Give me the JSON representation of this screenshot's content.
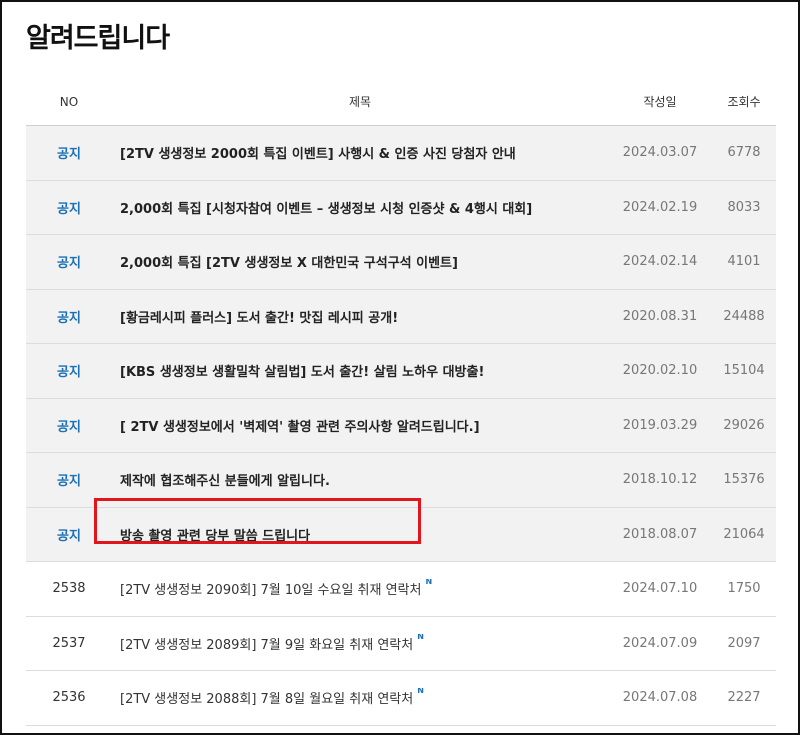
{
  "page": {
    "title": "알려드립니다"
  },
  "table": {
    "headers": {
      "no": "NO",
      "title": "제목",
      "date": "작성일",
      "views": "조회수"
    },
    "notices": [
      {
        "no": "공지",
        "title": "[2TV 생생정보 2000회 특집 이벤트] 사행시 & 인증 사진 당첨자 안내",
        "date": "2024.03.07",
        "views": "6778"
      },
      {
        "no": "공지",
        "title": "2,000회 특집 [시청자참여 이벤트 – 생생정보 시청 인증샷 & 4행시 대회]",
        "date": "2024.02.19",
        "views": "8033"
      },
      {
        "no": "공지",
        "title": "2,000회 특집 [2TV 생생정보 X 대한민국 구석구석 이벤트]",
        "date": "2024.02.14",
        "views": "4101"
      },
      {
        "no": "공지",
        "title": "[황금레시피 플러스] 도서 출간! 맛집 레시피 공개!",
        "date": "2020.08.31",
        "views": "24488"
      },
      {
        "no": "공지",
        "title": "[KBS 생생정보 생활밀착 살림법] 도서 출간! 살림 노하우 대방출!",
        "date": "2020.02.10",
        "views": "15104"
      },
      {
        "no": "공지",
        "title": "[ 2TV 생생정보에서 '벽제역' 촬영 관련 주의사항 알려드립니다.]",
        "date": "2019.03.29",
        "views": "29026"
      },
      {
        "no": "공지",
        "title": "제작에 협조해주신 분들에게 알립니다.",
        "date": "2018.10.12",
        "views": "15376"
      },
      {
        "no": "공지",
        "title": "방송 촬영 관련 당부 말씀 드립니다",
        "date": "2018.08.07",
        "views": "21064"
      }
    ],
    "posts": [
      {
        "no": "2538",
        "title": "[2TV 생생정보 2090회] 7월 10일 수요일 취재 연락처",
        "badge": "N",
        "date": "2024.07.10",
        "views": "1750"
      },
      {
        "no": "2537",
        "title": "[2TV 생생정보 2089회] 7월 9일 화요일 취재 연락처",
        "badge": "N",
        "date": "2024.07.09",
        "views": "2097"
      },
      {
        "no": "2536",
        "title": "[2TV 생생정보 2088회] 7월 8일 월요일 취재 연락처",
        "badge": "N",
        "date": "2024.07.08",
        "views": "2227"
      }
    ]
  }
}
